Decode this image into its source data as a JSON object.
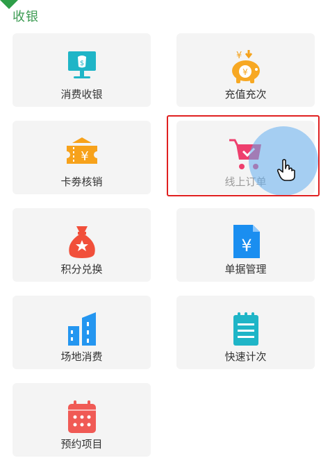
{
  "section": {
    "title": "收银"
  },
  "tiles": [
    {
      "label": "消费收银",
      "icon": "monitor-yuan-icon",
      "color": "#1fb5c7"
    },
    {
      "label": "充值充次",
      "icon": "piggy-bank-icon",
      "color": "#f5a21b"
    },
    {
      "label": "卡劵核销",
      "icon": "ticket-yuan-icon",
      "color": "#f7a21b"
    },
    {
      "label": "线上订单",
      "icon": "shopping-cart-icon",
      "color": "#ee3f6d"
    },
    {
      "label": "积分兑换",
      "icon": "money-bag-icon",
      "color": "#f14f3a"
    },
    {
      "label": "单据管理",
      "icon": "document-yuan-icon",
      "color": "#1a8ef0"
    },
    {
      "label": "场地消费",
      "icon": "buildings-icon",
      "color": "#2496f0"
    },
    {
      "label": "快速计次",
      "icon": "notepad-icon",
      "color": "#1fb5c7"
    },
    {
      "label": "预约项目",
      "icon": "calendar-icon",
      "color": "#f05a55"
    }
  ],
  "highlight": {
    "color": "#e02020",
    "target": "线上订单"
  }
}
